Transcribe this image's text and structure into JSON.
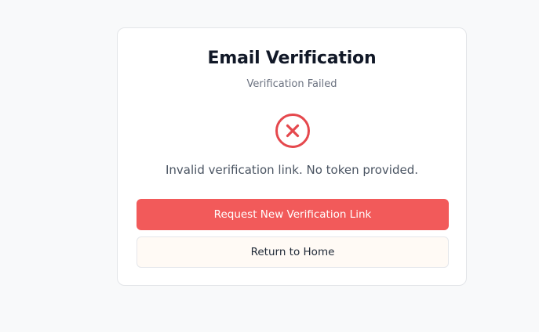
{
  "card": {
    "title": "Email Verification",
    "subtitle": "Verification Failed",
    "icon": "error-x-circle-icon",
    "message": "Invalid verification link. No token provided."
  },
  "actions": {
    "request_label": "Request New Verification Link",
    "home_label": "Return to Home"
  },
  "colors": {
    "error": "#e5484d",
    "primary_button": "#f25a5a",
    "background": "#f8f9fa"
  }
}
